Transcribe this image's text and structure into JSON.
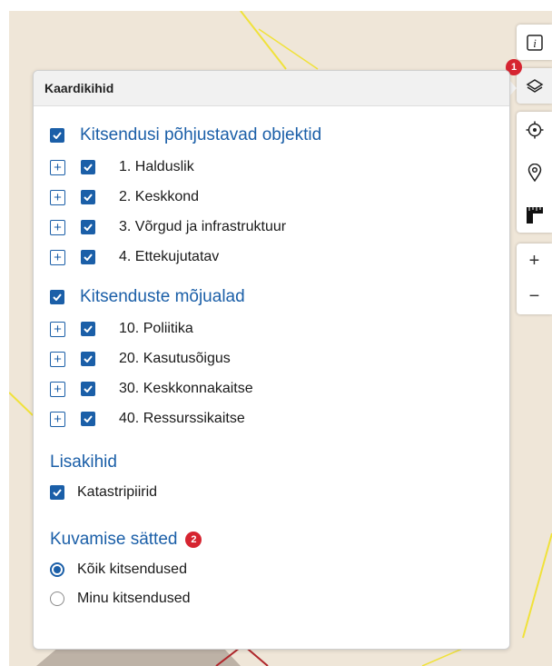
{
  "map": {
    "background_color": "#efe6d8",
    "road_color": "#f0e23a",
    "boundary_color": "#b0262b"
  },
  "toolbar": {
    "items": [
      {
        "icon": "info-icon"
      },
      {
        "icon": "layers-icon",
        "badge": "1"
      },
      {
        "icon": "locate-icon"
      },
      {
        "icon": "location-pin-icon"
      },
      {
        "icon": "ruler-icon"
      },
      {
        "icon": "zoom-in-icon",
        "label": "+"
      },
      {
        "icon": "zoom-out-icon",
        "label": "−"
      }
    ]
  },
  "panel": {
    "title": "Kaardikihid",
    "groups": [
      {
        "title": "Kitsendusi põhjustavad objektid",
        "checked": true,
        "items": [
          {
            "label": "1. Halduslik",
            "checked": true
          },
          {
            "label": "2. Keskkond",
            "checked": true
          },
          {
            "label": "3. Võrgud ja infrastruktuur",
            "checked": true
          },
          {
            "label": "4. Ettekujutatav",
            "checked": true
          }
        ]
      },
      {
        "title": "Kitsenduste mõjualad",
        "checked": true,
        "items": [
          {
            "label": "10. Poliitika",
            "checked": true
          },
          {
            "label": "20. Kasutusõigus",
            "checked": true
          },
          {
            "label": "30. Keskkonnakaitse",
            "checked": true
          },
          {
            "label": "40. Ressurssikaitse",
            "checked": true
          }
        ]
      }
    ],
    "extra_layers": {
      "title": "Lisakihid",
      "items": [
        {
          "label": "Katastripiirid",
          "checked": true
        }
      ]
    },
    "display_settings": {
      "title": "Kuvamise sätted",
      "badge": "2",
      "options": [
        {
          "label": "Kõik kitsendused",
          "selected": true
        },
        {
          "label": "Minu kitsendused",
          "selected": false
        }
      ]
    }
  },
  "colors": {
    "accent": "#1b5fa8",
    "badge": "#d62430"
  }
}
